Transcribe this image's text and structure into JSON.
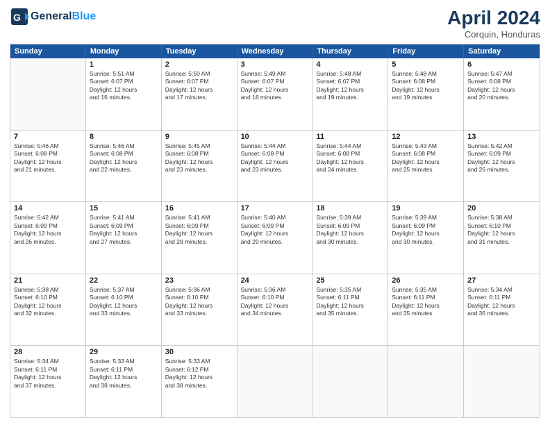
{
  "header": {
    "logo_general": "General",
    "logo_blue": "Blue",
    "month_year": "April 2024",
    "location": "Corquin, Honduras"
  },
  "days_of_week": [
    "Sunday",
    "Monday",
    "Tuesday",
    "Wednesday",
    "Thursday",
    "Friday",
    "Saturday"
  ],
  "weeks": [
    [
      {
        "day": "",
        "info": ""
      },
      {
        "day": "1",
        "info": "Sunrise: 5:51 AM\nSunset: 6:07 PM\nDaylight: 12 hours\nand 16 minutes."
      },
      {
        "day": "2",
        "info": "Sunrise: 5:50 AM\nSunset: 6:07 PM\nDaylight: 12 hours\nand 17 minutes."
      },
      {
        "day": "3",
        "info": "Sunrise: 5:49 AM\nSunset: 6:07 PM\nDaylight: 12 hours\nand 18 minutes."
      },
      {
        "day": "4",
        "info": "Sunrise: 5:48 AM\nSunset: 6:07 PM\nDaylight: 12 hours\nand 19 minutes."
      },
      {
        "day": "5",
        "info": "Sunrise: 5:48 AM\nSunset: 6:08 PM\nDaylight: 12 hours\nand 19 minutes."
      },
      {
        "day": "6",
        "info": "Sunrise: 5:47 AM\nSunset: 6:08 PM\nDaylight: 12 hours\nand 20 minutes."
      }
    ],
    [
      {
        "day": "7",
        "info": "Sunrise: 5:46 AM\nSunset: 6:08 PM\nDaylight: 12 hours\nand 21 minutes."
      },
      {
        "day": "8",
        "info": "Sunrise: 5:46 AM\nSunset: 6:08 PM\nDaylight: 12 hours\nand 22 minutes."
      },
      {
        "day": "9",
        "info": "Sunrise: 5:45 AM\nSunset: 6:08 PM\nDaylight: 12 hours\nand 23 minutes."
      },
      {
        "day": "10",
        "info": "Sunrise: 5:44 AM\nSunset: 6:08 PM\nDaylight: 12 hours\nand 23 minutes."
      },
      {
        "day": "11",
        "info": "Sunrise: 5:44 AM\nSunset: 6:08 PM\nDaylight: 12 hours\nand 24 minutes."
      },
      {
        "day": "12",
        "info": "Sunrise: 5:43 AM\nSunset: 6:08 PM\nDaylight: 12 hours\nand 25 minutes."
      },
      {
        "day": "13",
        "info": "Sunrise: 5:42 AM\nSunset: 6:09 PM\nDaylight: 12 hours\nand 26 minutes."
      }
    ],
    [
      {
        "day": "14",
        "info": "Sunrise: 5:42 AM\nSunset: 6:09 PM\nDaylight: 12 hours\nand 26 minutes."
      },
      {
        "day": "15",
        "info": "Sunrise: 5:41 AM\nSunset: 6:09 PM\nDaylight: 12 hours\nand 27 minutes."
      },
      {
        "day": "16",
        "info": "Sunrise: 5:41 AM\nSunset: 6:09 PM\nDaylight: 12 hours\nand 28 minutes."
      },
      {
        "day": "17",
        "info": "Sunrise: 5:40 AM\nSunset: 6:09 PM\nDaylight: 12 hours\nand 29 minutes."
      },
      {
        "day": "18",
        "info": "Sunrise: 5:39 AM\nSunset: 6:09 PM\nDaylight: 12 hours\nand 30 minutes."
      },
      {
        "day": "19",
        "info": "Sunrise: 5:39 AM\nSunset: 6:09 PM\nDaylight: 12 hours\nand 30 minutes."
      },
      {
        "day": "20",
        "info": "Sunrise: 5:38 AM\nSunset: 6:10 PM\nDaylight: 12 hours\nand 31 minutes."
      }
    ],
    [
      {
        "day": "21",
        "info": "Sunrise: 5:38 AM\nSunset: 6:10 PM\nDaylight: 12 hours\nand 32 minutes."
      },
      {
        "day": "22",
        "info": "Sunrise: 5:37 AM\nSunset: 6:10 PM\nDaylight: 12 hours\nand 33 minutes."
      },
      {
        "day": "23",
        "info": "Sunrise: 5:36 AM\nSunset: 6:10 PM\nDaylight: 12 hours\nand 33 minutes."
      },
      {
        "day": "24",
        "info": "Sunrise: 5:36 AM\nSunset: 6:10 PM\nDaylight: 12 hours\nand 34 minutes."
      },
      {
        "day": "25",
        "info": "Sunrise: 5:35 AM\nSunset: 6:11 PM\nDaylight: 12 hours\nand 35 minutes."
      },
      {
        "day": "26",
        "info": "Sunrise: 5:35 AM\nSunset: 6:11 PM\nDaylight: 12 hours\nand 35 minutes."
      },
      {
        "day": "27",
        "info": "Sunrise: 5:34 AM\nSunset: 6:11 PM\nDaylight: 12 hours\nand 36 minutes."
      }
    ],
    [
      {
        "day": "28",
        "info": "Sunrise: 5:34 AM\nSunset: 6:11 PM\nDaylight: 12 hours\nand 37 minutes."
      },
      {
        "day": "29",
        "info": "Sunrise: 5:33 AM\nSunset: 6:11 PM\nDaylight: 12 hours\nand 38 minutes."
      },
      {
        "day": "30",
        "info": "Sunrise: 5:33 AM\nSunset: 6:12 PM\nDaylight: 12 hours\nand 38 minutes."
      },
      {
        "day": "",
        "info": ""
      },
      {
        "day": "",
        "info": ""
      },
      {
        "day": "",
        "info": ""
      },
      {
        "day": "",
        "info": ""
      }
    ]
  ]
}
